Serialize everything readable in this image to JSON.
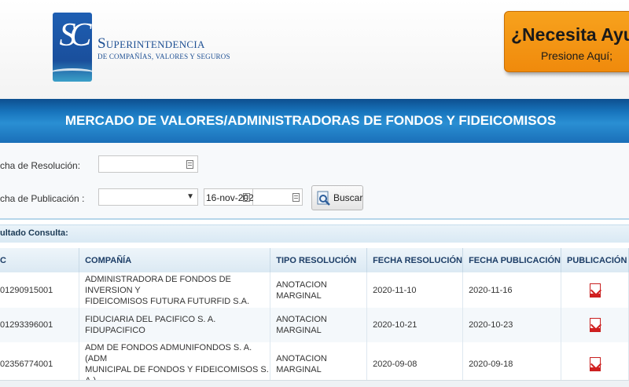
{
  "header": {
    "logo_initials": "SC",
    "logo_title": "Superintendencia",
    "logo_subtitle": "DE COMPAÑÍAS, VALORES Y SEGUROS"
  },
  "help": {
    "title": "¿Necesita Ayuda",
    "subtitle": "Presione Aquí;"
  },
  "banner": {
    "title": "MERCADO DE VALORES/ADMINISTRADORAS DE FONDOS Y FIDEICOMISOS"
  },
  "form": {
    "fecha_resolucion_label": "cha de Resolución:",
    "fecha_resolucion_value": "",
    "fecha_publicacion_label": "cha de Publicación :",
    "fecha_publicacion_select": "",
    "fecha_publicacion_from": "16-nov-202",
    "fecha_publicacion_to": "",
    "search_label": "Buscar"
  },
  "results": {
    "header_label": "ultado Consulta:",
    "columns": [
      "C",
      "COMPAÑÍA",
      "TIPO RESOLUCIÓN",
      "FECHA RESOLUCIÓN",
      "FECHA PUBLICACIÓN",
      "PUBLICACIÓN"
    ],
    "rows": [
      {
        "ruc": "01290915001",
        "company_line1": "ADMINISTRADORA DE FONDOS DE INVERSION Y",
        "company_line2": "FIDEICOMISOS FUTURA FUTURFID S.A.",
        "tipo": "ANOTACION MARGINAL",
        "fecha_resolucion": "2020-11-10",
        "fecha_publicacion": "2020-11-16"
      },
      {
        "ruc": "01293396001",
        "company_line1": "FIDUCIARIA DEL PACIFICO S. A. FIDUPACIFICO",
        "company_line2": "",
        "tipo": "ANOTACION MARGINAL",
        "fecha_resolucion": "2020-10-21",
        "fecha_publicacion": "2020-10-23"
      },
      {
        "ruc": "02356774001",
        "company_line1": "ADM DE FONDOS ADMUNIFONDOS S. A. (ADM",
        "company_line2": "MUNICIPAL DE FONDOS Y FIDEICOMISOS S. A.)",
        "tipo": "ANOTACION MARGINAL",
        "fecha_resolucion": "2020-09-08",
        "fecha_publicacion": "2020-09-18"
      }
    ]
  },
  "icons": {
    "calendar": "calendar-icon",
    "pdf": "pdf-icon",
    "search": "search-icon",
    "dropdown": "chevron-down-icon"
  },
  "colors": {
    "banner": "#1875bd",
    "help_button": "#f29310",
    "brand_blue": "#1d4f93",
    "pdf_red": "#d12020"
  }
}
